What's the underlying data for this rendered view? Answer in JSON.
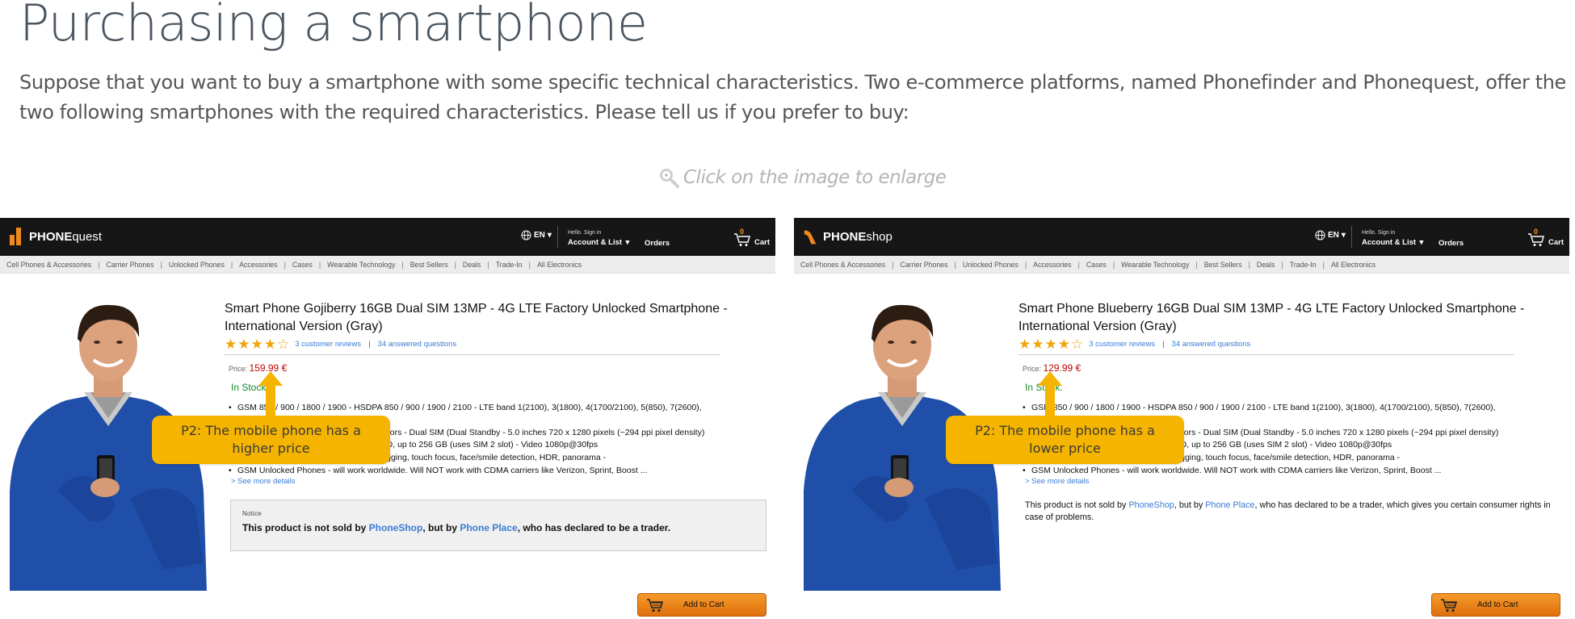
{
  "page": {
    "title": "Purchasing a smartphone",
    "intro": "Suppose that you want to buy a smartphone with some specific technical characteristics. Two e-commerce platforms, named Phonefinder and Phonequest, offer the two following smartphones with the required characteristics. Please tell us if you prefer to buy:",
    "enlarge_hint": "Click on the image to enlarge"
  },
  "colors": {
    "logo_left": "#f08a1c",
    "logo_right": "#f08a1c",
    "price": "#c40000",
    "in_stock": "#138a26",
    "link": "#3a7bd5",
    "callout": "#f5b400",
    "star": "#f0a30a"
  },
  "common": {
    "lang": "EN",
    "hello": "Hello. Sign in",
    "account": "Account & List",
    "orders": "Orders",
    "cart_label": "Cart",
    "cart_count": "0",
    "categories": [
      "Cell Phones & Accessories",
      "Carrier Phones",
      "Unlocked Phones",
      "Accessories",
      "Cases",
      "Wearable Technology",
      "Best Sellers",
      "Deals",
      "Trade-In",
      "All Electronics"
    ],
    "reviews": "3 customer reviews",
    "questions": "34 answered questions",
    "price_label": "Price:",
    "in_stock": "In Stock.",
    "bullets": [
      "GSM 850 / 900 / 1800 / 1900 - HSDPA 850 / 900 / 1900 / 2100 - LTE band 1(2100), 3(1800), 4(1700/2100), 5(850), 7(2600),",
      "16M colors - Dual SIM (Dual Standby - 5.0 inches 720 x 1280 pixels (~294 ppi pixel density)",
      "microSD, up to 256 GB (uses SIM 2 slot) - Video 1080p@30fps",
      "Geo-tagging, touch focus, face/smile detection, HDR, panorama -",
      "GSM Unlocked Phones - will work worldwide. Will NOT work with CDMA carriers like Verizon, Sprint, Boost ..."
    ],
    "see_more": "> See more details",
    "add_to_cart": "Add to Cart",
    "stars": 4
  },
  "left": {
    "brand_bold": "PHONE",
    "brand_rest": "quest",
    "product_title": "Smart Phone Gojiberry 16GB Dual SIM 13MP - 4G LTE Factory Unlocked Smartphone - International Version (Gray)",
    "price": "159.99 €",
    "callout": "P2: The mobile phone has a higher price",
    "notice_title": "Notice",
    "notice_pre": "This product is not sold by ",
    "notice_seller": "PhoneShop",
    "notice_mid": ", but by ",
    "notice_trader": "Phone Place",
    "notice_post": ", who has declared to be a trader."
  },
  "right": {
    "brand_bold": "PHONE",
    "brand_rest": "shop",
    "product_title": "Smart Phone Blueberry 16GB Dual SIM 13MP - 4G LTE Factory Unlocked Smartphone - International Version (Gray)",
    "price": "129.99 €",
    "callout": "P2: The mobile phone has a lower price",
    "notice_pre": "This product is not sold by ",
    "notice_seller": "PhoneShop",
    "notice_mid": ", but by ",
    "notice_trader": "Phone Place",
    "notice_post": ", who has declared to be a trader, which gives you certain consumer rights in case of problems."
  }
}
